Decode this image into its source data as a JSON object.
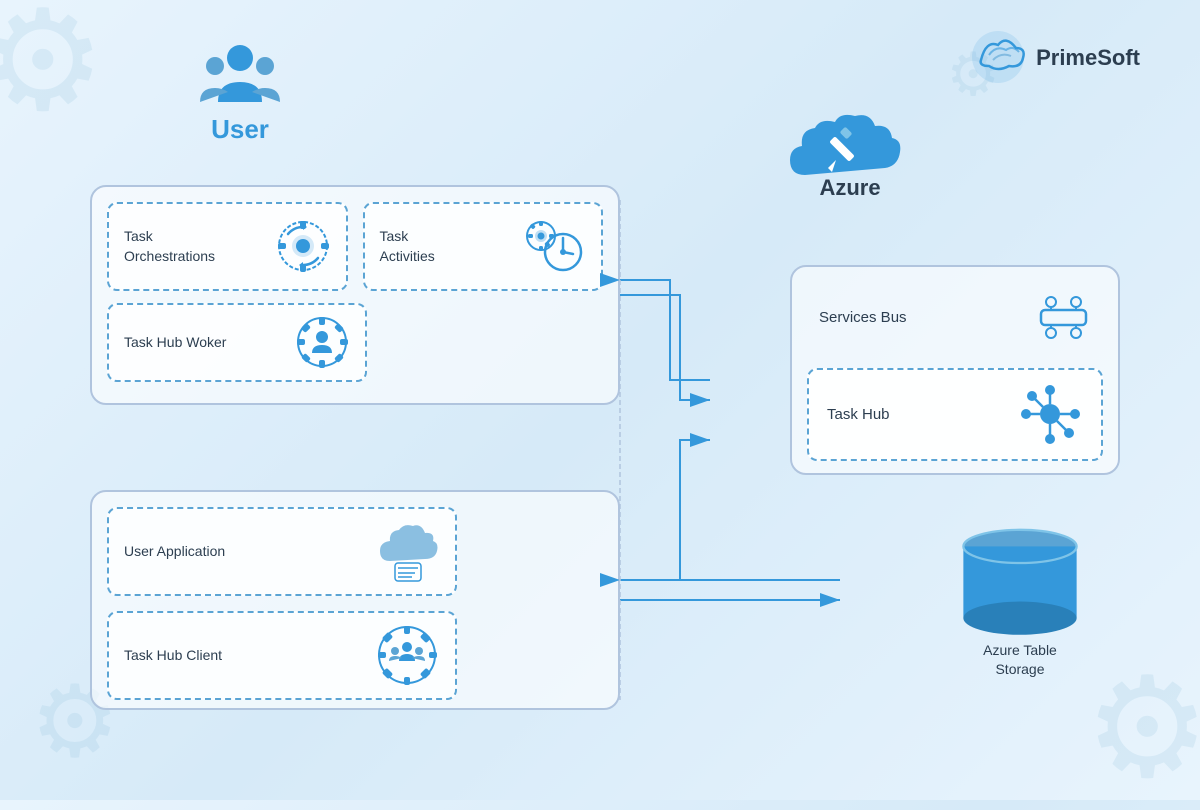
{
  "logo": {
    "name": "PrimeSoft",
    "alt": "PrimeSoft Logo"
  },
  "user": {
    "label": "User"
  },
  "azure": {
    "label": "Azure"
  },
  "durable_functions": {
    "task_orchestrations": "Task\nOrchestrations",
    "task_activities": "Task\nActivities",
    "task_hub_worker": "Task Hub Woker"
  },
  "azure_services": {
    "services_bus": "Services Bus",
    "task_hub": "Task Hub"
  },
  "client_section": {
    "user_application": "User Application",
    "task_hub_client": "Task Hub Client"
  },
  "storage": {
    "label": "Azure Table\nStorage"
  }
}
